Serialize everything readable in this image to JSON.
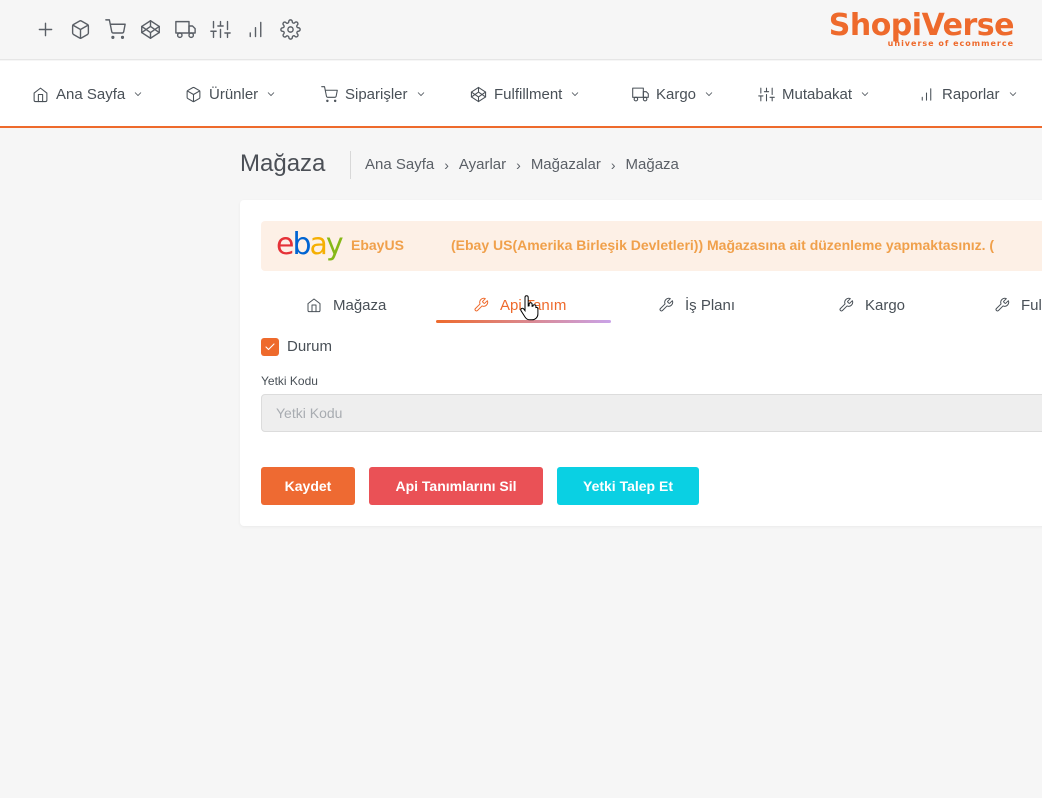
{
  "brand": {
    "name": "ShopiVerse",
    "tagline": "universe of ecommerce",
    "accent": "#ee6a2c"
  },
  "toolbar": {
    "icons": [
      "plus-icon",
      "box-icon",
      "cart-icon",
      "codepen-icon",
      "truck-icon",
      "sliders-icon",
      "bar-chart-icon",
      "gear-icon"
    ]
  },
  "nav": {
    "items": [
      {
        "label": "Ana Sayfa",
        "icon": "home-icon"
      },
      {
        "label": "Ürünler",
        "icon": "box-icon"
      },
      {
        "label": "Siparişler",
        "icon": "cart-icon"
      },
      {
        "label": "Fulfillment",
        "icon": "codepen-icon"
      },
      {
        "label": "Kargo",
        "icon": "truck-icon"
      },
      {
        "label": "Mutabakat",
        "icon": "sliders-icon"
      },
      {
        "label": "Raporlar",
        "icon": "bar-chart-icon"
      }
    ]
  },
  "page": {
    "title": "Mağaza",
    "breadcrumb": [
      "Ana Sayfa",
      "Ayarlar",
      "Mağazalar",
      "Mağaza"
    ]
  },
  "banner": {
    "logo_text": "ebay",
    "store_name": "EbayUS",
    "message": "(Ebay US(Amerika Birleşik Devletleri)) Mağazasına ait düzenleme yapmaktasınız. (",
    "message_color": "#f0a04b"
  },
  "tabs": [
    {
      "label": "Mağaza",
      "icon": "home-icon",
      "active": false
    },
    {
      "label": "Api Tanım",
      "icon": "wrench-icon",
      "active": true
    },
    {
      "label": "İş Planı",
      "icon": "wrench-icon",
      "active": false
    },
    {
      "label": "Kargo",
      "icon": "wrench-icon",
      "active": false
    },
    {
      "label": "Ful",
      "icon": "wrench-icon",
      "active": false
    }
  ],
  "form": {
    "status_label": "Durum",
    "status_checked": true,
    "auth_code_label": "Yetki Kodu",
    "auth_code_placeholder": "Yetki Kodu",
    "auth_code_value": ""
  },
  "buttons": {
    "save": "Kaydet",
    "delete_api": "Api Tanımlarını Sil",
    "request_auth": "Yetki Talep Et"
  }
}
